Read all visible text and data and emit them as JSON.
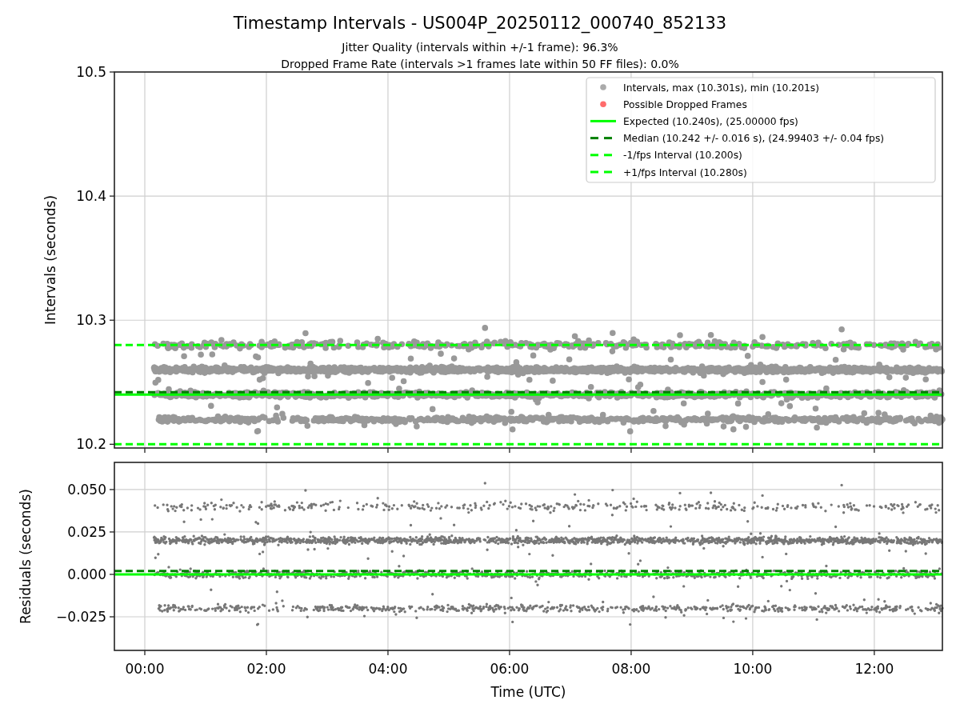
{
  "title": "Timestamp Intervals - US004P_20250112_000740_852133",
  "subtitles": [
    "Jitter Quality (intervals within +/-1 frame): 96.3%",
    "Dropped Frame Rate (intervals >1 frames late within 50 FF files): 0.0%"
  ],
  "intervals_panel": {
    "legend": [
      {
        "label": "Intervals, max (10.301s), min (10.201s)",
        "kind": "marker",
        "color": "#aaaaaa"
      },
      {
        "label": "Possible Dropped Frames",
        "kind": "marker",
        "color": "#ff6b6b"
      },
      {
        "label": "Expected (10.240s), (25.00000 fps)",
        "kind": "solid",
        "color": "#00ff00"
      },
      {
        "label": "Median (10.242 +/- 0.016 s), (24.99403 +/- 0.04 fps)",
        "kind": "dashed",
        "color": "#008000"
      },
      {
        "label": "-1/fps Interval (10.200s)",
        "kind": "dashed",
        "color": "#00ff00"
      },
      {
        "label": "+1/fps Interval (10.280s)",
        "kind": "dashed",
        "color": "#00ff00"
      }
    ],
    "chart_data": {
      "type": "line",
      "grid": true,
      "ylabel": "Intervals (seconds)",
      "x": [
        -0.5,
        13.12
      ],
      "xlim": [
        -0.5,
        13.12
      ],
      "ylim": [
        10.197,
        10.5
      ],
      "yticks": [
        10.2,
        10.3,
        10.4,
        10.5
      ],
      "series": [
        {
          "color": "#00ff00",
          "line_style": "solid",
          "values": [
            10.24,
            10.24
          ]
        },
        {
          "color": "#008000",
          "line_style": "dashed",
          "values": [
            10.242,
            10.242
          ]
        },
        {
          "color": "#00ff00",
          "line_style": "dashed",
          "values": [
            10.2,
            10.2
          ]
        },
        {
          "color": "#00ff00",
          "line_style": "dashed",
          "values": [
            10.28,
            10.28
          ]
        }
      ]
    }
  },
  "residuals_panel": {
    "chart_data": {
      "type": "line",
      "grid": true,
      "xlabel": "Time (UTC)",
      "ylabel": "Residuals (seconds)",
      "x": [
        -0.5,
        13.12
      ],
      "xlim": [
        -0.5,
        13.12
      ],
      "ylim": [
        -0.0448,
        0.066
      ],
      "xticks": [
        {
          "value": 0,
          "label": "00:00"
        },
        {
          "value": 2,
          "label": "02:00"
        },
        {
          "value": 4,
          "label": "04:00"
        },
        {
          "value": 6,
          "label": "06:00"
        },
        {
          "value": 8,
          "label": "08:00"
        },
        {
          "value": 10,
          "label": "10:00"
        },
        {
          "value": 12,
          "label": "12:00"
        }
      ],
      "yticks": [
        {
          "value": 0.05,
          "label": "0.050"
        },
        {
          "value": 0.025,
          "label": "0.025"
        },
        {
          "value": 0,
          "label": "0.000"
        },
        {
          "value": -0.025,
          "label": "−0.025"
        }
      ],
      "series": [
        {
          "color": "#008000",
          "line_style": "dashed",
          "values": [
            0.002,
            0.002
          ]
        },
        {
          "color": "#00ff00",
          "line_style": "solid",
          "values": [
            0,
            0
          ]
        }
      ]
    }
  }
}
